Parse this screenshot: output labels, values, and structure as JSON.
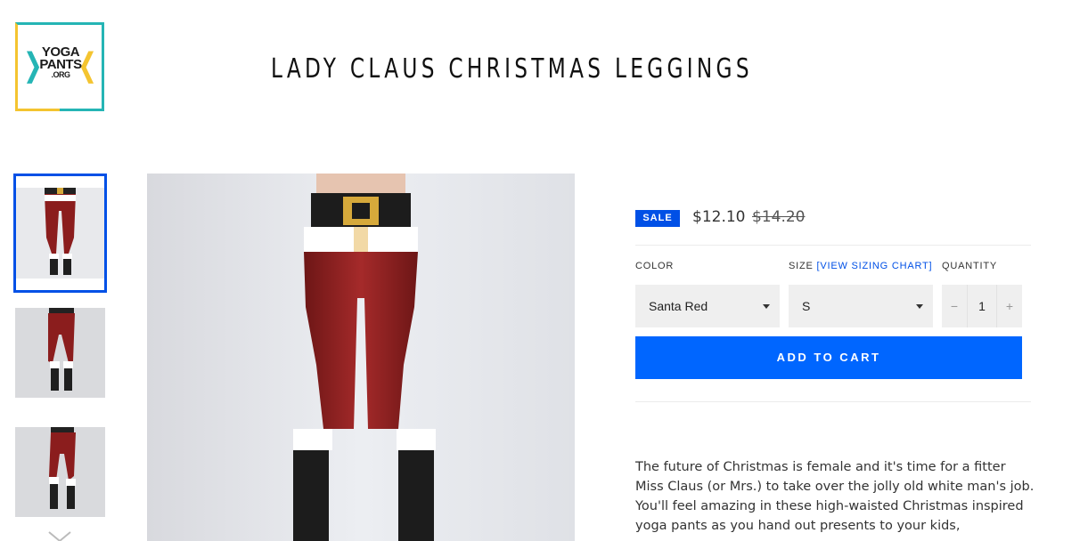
{
  "brand": {
    "logo_line1": "YOGA",
    "logo_line2": "PANTS",
    "logo_line3": ".ORG",
    "colors": {
      "teal": "#25b5b5",
      "yellow": "#f4c430"
    }
  },
  "product": {
    "title": "LADY CLAUS CHRISTMAS LEGGINGS",
    "sale_badge": "SALE",
    "price": "$12.10",
    "compare_price": "$14.20",
    "accent_color": "#0066ff",
    "thumbnails": [
      {
        "label": "front view",
        "active": true
      },
      {
        "label": "back view",
        "active": false
      },
      {
        "label": "side view",
        "active": false
      }
    ]
  },
  "options": {
    "color_label": "COLOR",
    "color_value": "Santa Red",
    "size_label": "SIZE",
    "size_link": "[VIEW SIZING CHART]",
    "size_value": "S",
    "quantity_label": "QUANTITY",
    "quantity_minus": "−",
    "quantity_value": "1",
    "quantity_plus": "+"
  },
  "actions": {
    "add_to_cart": "ADD TO CART"
  },
  "description": "The future of Christmas is female and it's time for a fitter Miss Claus (or Mrs.) to take over the jolly old white man's job. You'll feel amazing in these high-waisted Christmas inspired yoga pants as you hand out presents to your kids,"
}
